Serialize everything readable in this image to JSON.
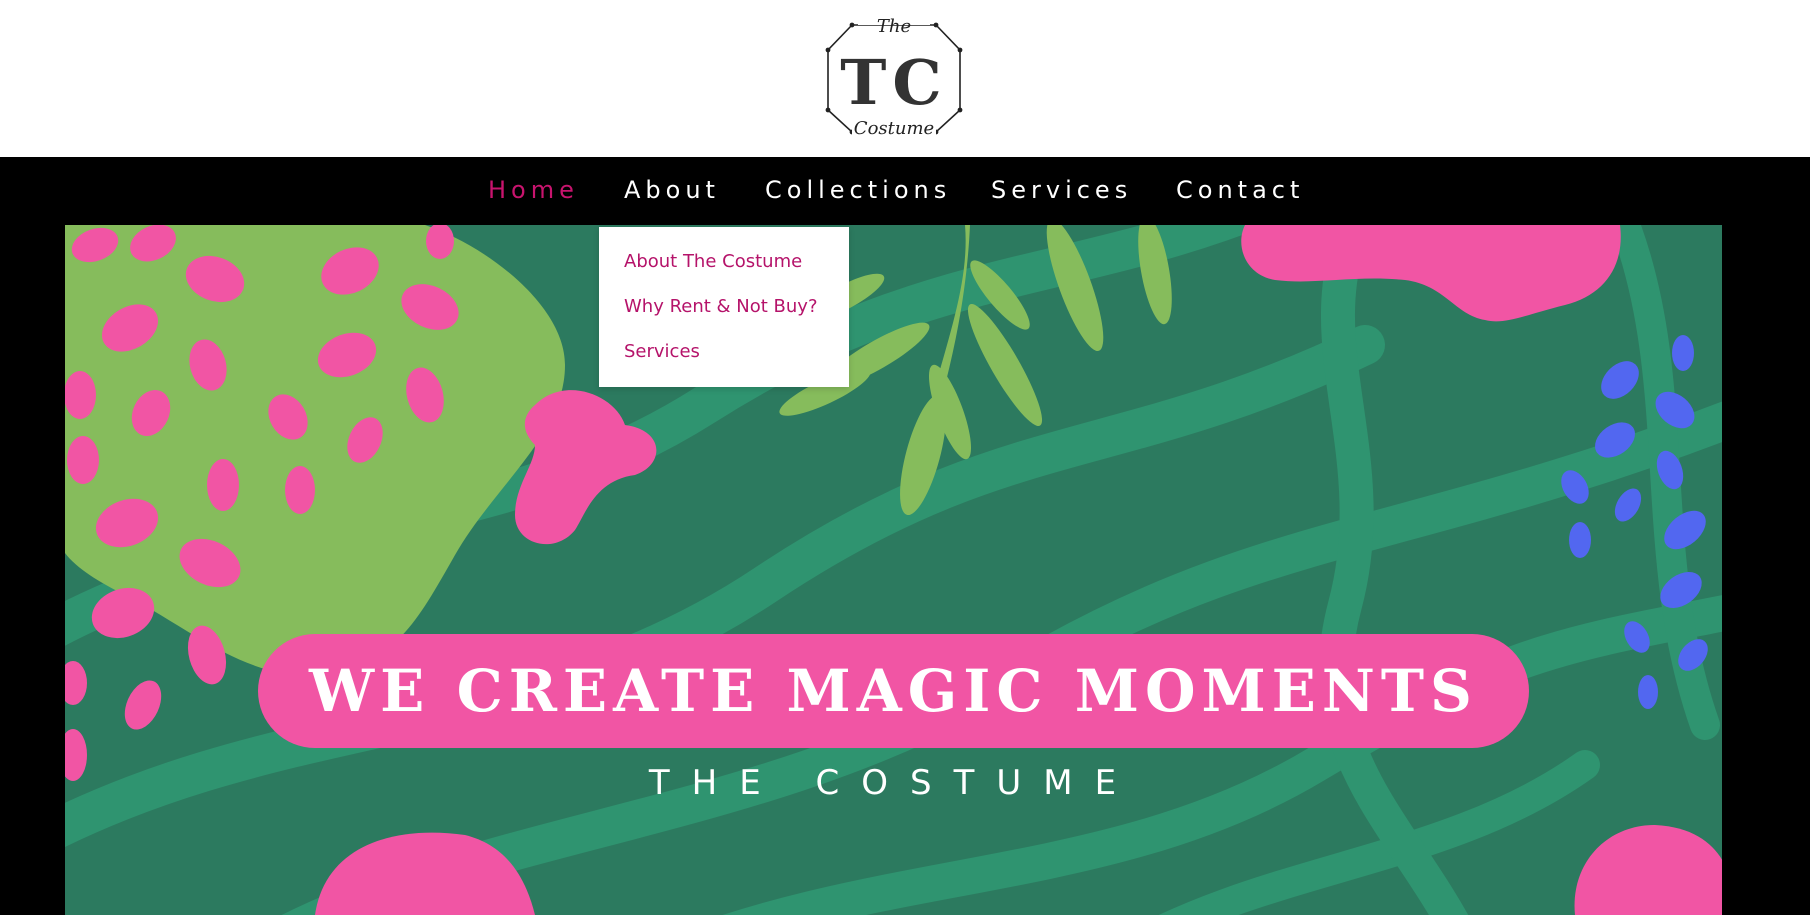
{
  "brand": {
    "logo_top_word": "The",
    "logo_monogram": "TC",
    "logo_bottom_word": "Costume"
  },
  "nav": {
    "items": [
      {
        "label": "Home",
        "active": true
      },
      {
        "label": "About",
        "active": false
      },
      {
        "label": "Collections",
        "active": false
      },
      {
        "label": "Services",
        "active": false
      },
      {
        "label": "Contact",
        "active": false
      }
    ],
    "active_color": "#c8146e"
  },
  "about_dropdown": {
    "items": [
      {
        "label": "About The Costume"
      },
      {
        "label": "Why Rent & Not Buy?"
      },
      {
        "label": "Services"
      }
    ],
    "text_color": "#b5136a"
  },
  "hero": {
    "headline": "WE CREATE MAGIC MOMENTS",
    "subheadline": "THE COSTUME",
    "colors": {
      "background": "#2c7a5f",
      "stripes": "#2f9470",
      "pink": "#f155a4",
      "lime": "#86bc5c",
      "blue": "#5267f0"
    }
  }
}
